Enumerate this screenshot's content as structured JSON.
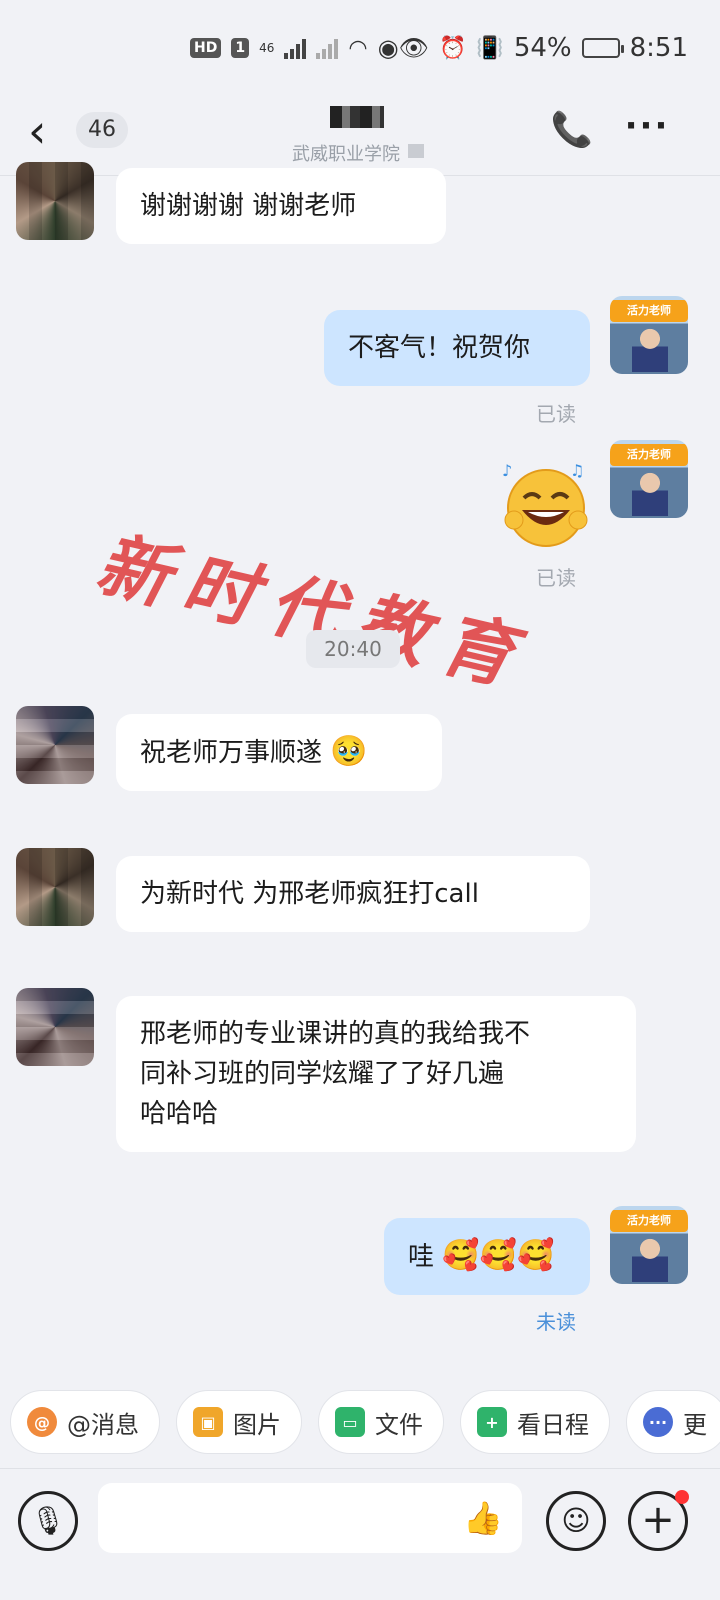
{
  "status_bar": {
    "hd_badge": "HD",
    "sim_slot": "1",
    "network": "46",
    "battery": "54%",
    "battery_level": 0.54,
    "time": "8:51"
  },
  "header": {
    "back_count": "46",
    "subtitle": "武威职业学院",
    "video_call_icon": "video-call-icon",
    "more_icon": "more-icon"
  },
  "messages": [
    {
      "side": "left",
      "text": "谢谢谢谢  谢谢老师"
    },
    {
      "side": "right",
      "text": "不客气！祝贺你",
      "status": "已读"
    },
    {
      "side": "right",
      "sticker": "laughing-emoji",
      "status": "已读"
    },
    {
      "side": "left",
      "text": "祝老师万事顺遂",
      "emoji": "🥹"
    },
    {
      "side": "left",
      "text": "为新时代  为邢老师疯狂打call"
    },
    {
      "side": "left",
      "text_lines": [
        "邢老师的专业课讲的真的我给我不",
        "同补习班的同学炫耀了了好几遍",
        "哈哈哈"
      ]
    },
    {
      "side": "right",
      "text": "哇",
      "emojis": "🥰🥰🥰",
      "status": "未读"
    }
  ],
  "time_separator": "20:40",
  "watermark": "新时代教育",
  "teacher_badge": "活力老师",
  "quick_actions": [
    {
      "label": "@消息",
      "icon": "at-icon",
      "color": "#f08a3c"
    },
    {
      "label": "图片",
      "icon": "image-icon",
      "color": "#f0a62a"
    },
    {
      "label": "文件",
      "icon": "folder-icon",
      "color": "#2fb36b"
    },
    {
      "label": "看日程",
      "icon": "calendar-icon",
      "color": "#2fb36b"
    },
    {
      "label": "更",
      "icon": "more-dots-icon",
      "color": "#4a6cd4"
    }
  ],
  "input": {
    "placeholder": ""
  }
}
